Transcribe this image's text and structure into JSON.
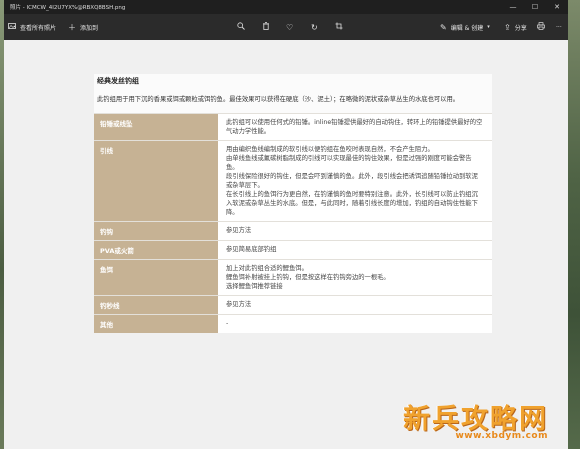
{
  "window": {
    "title": "照片 - ICMCW_4I2U7YX%@RBXQ8BSH.png",
    "controls": [
      "—",
      "☐",
      "✕"
    ]
  },
  "toolbar": {
    "view_all": "查看所有照片",
    "add": "添加到",
    "edit_create": "编辑 & 创建",
    "share": "分享",
    "more": "···"
  },
  "doc": {
    "title": "经典发丝钓组",
    "intro": "此钓组用于用下沉的香果或饵或颗粒或饵钓鱼。最佳效果可以获得在硬底（沙、泥土）；在略微的泥状或杂草丛生的水底也可以用。",
    "rows": [
      {
        "key": "铅锤或线坠",
        "lines": [
          "此钓组可以使用任何式的铅锤。inline铅锤提供最好的自动钩住，转环上的铅锤提供最好的空气动力学性能。"
        ]
      },
      {
        "key": "引线",
        "lines": [
          "用由编织鱼线编制成的软引线以便钓组在鱼咬时表现自然，不会产生阻力。",
          "由单线鱼线或氟碳树脂制成的引线可以实现最佳的钩住效果，但是过强的刚度可能会警告鱼。",
          "段引线保险很好的钩住，但是会吓到谨慎的鱼。此外，段引线会把诱饵追随铅锤拉动到软泥或杂草层下。",
          "在长引线上的鱼饵行为更自然，在钓谨慎的鱼时要特别注意。此外，长引线可以防止钓组沉入软泥或杂草丛生的水底。但是，与此同时，随着引线长度的增加，钓组的自动钩住性能下降。"
        ]
      },
      {
        "key": "钓钩",
        "lines": [
          "参见方法"
        ]
      },
      {
        "key": "PVA或火箭",
        "lines": [
          "参见简易底部钓组"
        ]
      },
      {
        "key": "鱼饵",
        "lines": [
          "加上对此钓组合适的鲤鱼饵。",
          "鲤鱼饵补射被挂上钓钩，但是按这样在钓钩旁边的一根毛。",
          "选择鲤鱼饵推荐链接"
        ]
      },
      {
        "key": "钓秒线",
        "lines": [
          "参见方法"
        ]
      },
      {
        "key": "其他",
        "lines": [
          "-"
        ]
      }
    ]
  },
  "watermark": {
    "main": "新兵攻略网",
    "url": "www.xbdym.com"
  },
  "colors": {
    "key_cell": "#c6b294",
    "toolbar": "#2b2b2b",
    "titlebar": "#1f1f1f",
    "watermark": "#f0a22e"
  }
}
